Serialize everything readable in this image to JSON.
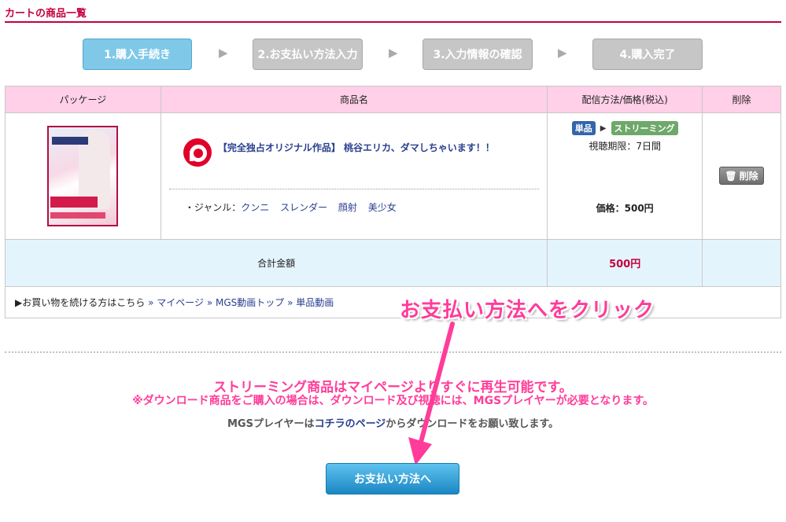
{
  "header": {
    "title": "カートの商品一覧"
  },
  "steps": [
    {
      "label": "1.購入手続き",
      "state": "active"
    },
    {
      "label": "2.お支払い方法入力",
      "state": "inactive"
    },
    {
      "label": "3.入力情報の確認",
      "state": "inactive"
    },
    {
      "label": "4.購入完了",
      "state": "inactive"
    }
  ],
  "step_arrow": "▶",
  "table": {
    "headers": [
      "パッケージ",
      "商品名",
      "配信方法/価格(税込)",
      "削除"
    ],
    "item": {
      "title": "【完全独占オリジナル作品】 桃谷エリカ、ダマしちゃいます！！",
      "genre_label": "・ジャンル：",
      "genres": [
        "クンニ",
        "スレンダー",
        "顔射",
        "美少女"
      ],
      "badge_single": "単品",
      "badge_arrow": "▶",
      "badge_streaming": "ストリーミング",
      "period": "視聴期限：7日間",
      "price": "価格：500円",
      "delete_label": "削除"
    },
    "total_label": "合計金額",
    "total_amount": "500円",
    "continue_text": "▶お買い物を続ける方はこちら",
    "links": [
      "マイページ",
      "MGS動画トップ",
      "単品動画"
    ],
    "link_sep": "»"
  },
  "annotation": "お支払い方法へをクリック",
  "notices": {
    "line1": "ストリーミング商品はマイページよりすぐに再生可能です。",
    "line2": "※ダウンロード商品をご購入の場合は、ダウンロード及び視聴には、MGSプレイヤーが必要となります。",
    "player_prefix": "MGSプレイヤーは",
    "player_link": "コチラのページ",
    "player_suffix": "からダウンロードをお願い致します。"
  },
  "pay_button": "お支払い方法へ",
  "colors": {
    "accent": "#c5003e",
    "pink": "#ff3c9a",
    "link": "#2a3f8f",
    "header_bg": "#ffd0e8",
    "total_bg": "#e4f4fd"
  }
}
